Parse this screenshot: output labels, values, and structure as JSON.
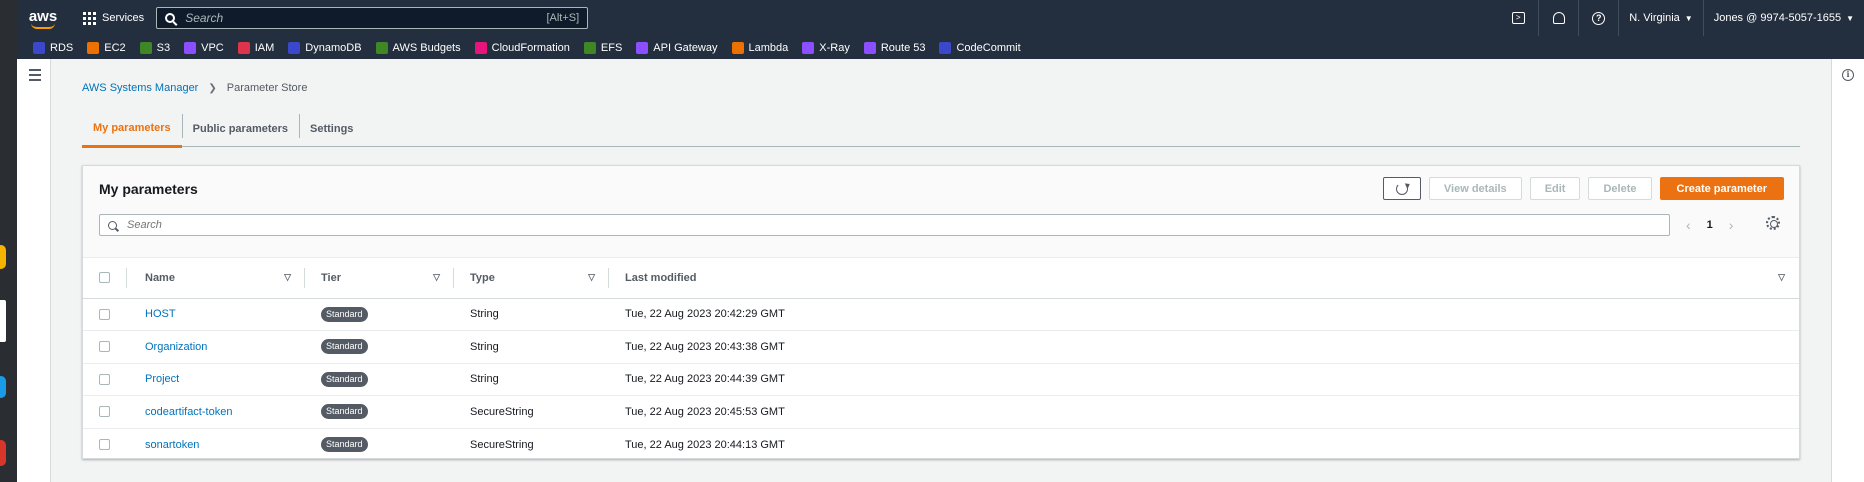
{
  "nav": {
    "logo": "aws",
    "services_label": "Services",
    "search_placeholder": "Search",
    "search_shortcut": "[Alt+S]",
    "region": "N. Virginia",
    "account": "Jones @ 9974-5057-1655"
  },
  "favorites": [
    {
      "label": "RDS",
      "color": "#3b48cc"
    },
    {
      "label": "EC2",
      "color": "#ed7100"
    },
    {
      "label": "S3",
      "color": "#3f8624"
    },
    {
      "label": "VPC",
      "color": "#8c4fff"
    },
    {
      "label": "IAM",
      "color": "#dd344c"
    },
    {
      "label": "DynamoDB",
      "color": "#3b48cc"
    },
    {
      "label": "AWS Budgets",
      "color": "#3f8624"
    },
    {
      "label": "CloudFormation",
      "color": "#e7157b"
    },
    {
      "label": "EFS",
      "color": "#3f8624"
    },
    {
      "label": "API Gateway",
      "color": "#8c4fff"
    },
    {
      "label": "Lambda",
      "color": "#ed7100"
    },
    {
      "label": "X-Ray",
      "color": "#8c4fff"
    },
    {
      "label": "Route 53",
      "color": "#8c4fff"
    },
    {
      "label": "CodeCommit",
      "color": "#3b48cc"
    }
  ],
  "breadcrumb": {
    "parent": "AWS Systems Manager",
    "current": "Parameter Store"
  },
  "tabs": {
    "my_params": "My parameters",
    "public_params": "Public parameters",
    "settings": "Settings"
  },
  "panel": {
    "title": "My parameters",
    "view_details": "View details",
    "edit": "Edit",
    "delete": "Delete",
    "create": "Create parameter",
    "search_placeholder": "Search",
    "page": "1"
  },
  "table": {
    "headers": {
      "name": "Name",
      "tier": "Tier",
      "type": "Type",
      "last_modified": "Last modified"
    },
    "rows": [
      {
        "name": "HOST",
        "tier": "Standard",
        "type": "String",
        "modified": "Tue, 22 Aug 2023 20:42:29 GMT"
      },
      {
        "name": "Organization",
        "tier": "Standard",
        "type": "String",
        "modified": "Tue, 22 Aug 2023 20:43:38 GMT"
      },
      {
        "name": "Project",
        "tier": "Standard",
        "type": "String",
        "modified": "Tue, 22 Aug 2023 20:44:39 GMT"
      },
      {
        "name": "codeartifact-token",
        "tier": "Standard",
        "type": "SecureString",
        "modified": "Tue, 22 Aug 2023 20:45:53 GMT"
      },
      {
        "name": "sonartoken",
        "tier": "Standard",
        "type": "SecureString",
        "modified": "Tue, 22 Aug 2023 20:44:13 GMT"
      }
    ]
  }
}
